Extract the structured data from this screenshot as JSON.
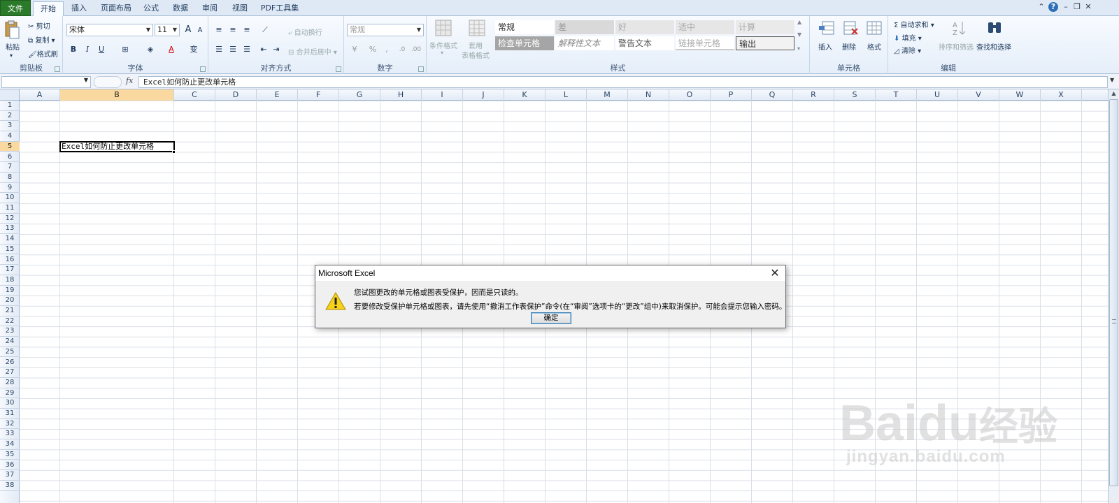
{
  "tabs": {
    "file": "文件",
    "home": "开始",
    "insert": "插入",
    "page_layout": "页面布局",
    "formulas": "公式",
    "data": "数据",
    "review": "审阅",
    "view": "视图",
    "pdf_tools": "PDF工具集"
  },
  "ribbon": {
    "clipboard": {
      "label": "剪贴板",
      "paste": "粘贴",
      "cut": "剪切",
      "copy": "复制",
      "format_painter": "格式刷"
    },
    "font": {
      "label": "字体",
      "font_name": "宋体",
      "font_size": "11",
      "bold": "B",
      "italic": "I",
      "underline": "U",
      "grow": "A",
      "shrink": "A",
      "font_color": "A",
      "phonetic": "变"
    },
    "alignment": {
      "label": "对齐方式",
      "wrap_text": "自动换行",
      "merge_center": "合并后居中"
    },
    "number": {
      "label": "数字",
      "format": "常规",
      "percent": "%",
      "comma": ","
    },
    "styles": {
      "label": "样式",
      "conditional_formatting": "条件格式",
      "format_as_table_1": "套用",
      "format_as_table_2": "表格格式",
      "cell_styles": [
        {
          "name": "常规",
          "bg": "#ffffff",
          "color": "#222222"
        },
        {
          "name": "差",
          "bg": "#d9d9d9",
          "color": "#999999"
        },
        {
          "name": "好",
          "bg": "#e6e6e6",
          "color": "#aaaaaa"
        },
        {
          "name": "适中",
          "bg": "#e6e6e6",
          "color": "#aaaaaa"
        },
        {
          "name": "计算",
          "bg": "#eaeaea",
          "color": "#aaaaaa"
        },
        {
          "name": "检查单元格",
          "bg": "#a5a5a5",
          "color": "#ffffff"
        },
        {
          "name": "解释性文本",
          "bg": "#ffffff",
          "color": "#888888"
        },
        {
          "name": "警告文本",
          "bg": "#ffffff",
          "color": "#555555"
        },
        {
          "name": "链接单元格",
          "bg": "#ffffff",
          "color": "#aaaaaa"
        },
        {
          "name": "输出",
          "bg": "#f2f2f2",
          "color": "#333333"
        }
      ]
    },
    "cells": {
      "label": "单元格",
      "insert": "插入",
      "delete": "删除",
      "format": "格式"
    },
    "editing": {
      "label": "编辑",
      "autosum": "自动求和",
      "fill": "填充",
      "clear": "清除",
      "sort_filter": "排序和筛选",
      "find_select": "查找和选择"
    }
  },
  "formula_bar": {
    "fx": "fx",
    "content": "Excel如何防止更改单元格"
  },
  "grid": {
    "columns": [
      "A",
      "B",
      "C",
      "D",
      "E",
      "F",
      "G",
      "H",
      "I",
      "J",
      "K",
      "L",
      "M",
      "N",
      "O",
      "P",
      "Q",
      "R",
      "S",
      "T",
      "U",
      "V",
      "W",
      "X"
    ],
    "active_column": "B",
    "rows": [
      "1",
      "2",
      "3",
      "4",
      "5",
      "6",
      "7",
      "8",
      "9",
      "10",
      "11",
      "12",
      "13",
      "14",
      "15",
      "16",
      "17",
      "18",
      "19",
      "20",
      "21",
      "22",
      "23",
      "24",
      "25",
      "26",
      "27",
      "28",
      "29",
      "30",
      "31",
      "32",
      "33",
      "34",
      "35",
      "36",
      "37",
      "38"
    ],
    "active_row": "5",
    "active_cell_text": "Excel如何防止更改单元格"
  },
  "dialog": {
    "title": "Microsoft Excel",
    "close": "✕",
    "line1": "您试图更改的单元格或图表受保护，因而是只读的。",
    "line2": "若要修改受保护单元格或图表，请先使用“撤消工作表保护”命令(在“审阅”选项卡的“更改”组中)来取消保护。可能会提示您输入密码。",
    "ok": "确定"
  },
  "watermark": {
    "brand": "Bai",
    "brand2": "du",
    "brand3": "经验",
    "site": "jingyan.baidu.com"
  }
}
